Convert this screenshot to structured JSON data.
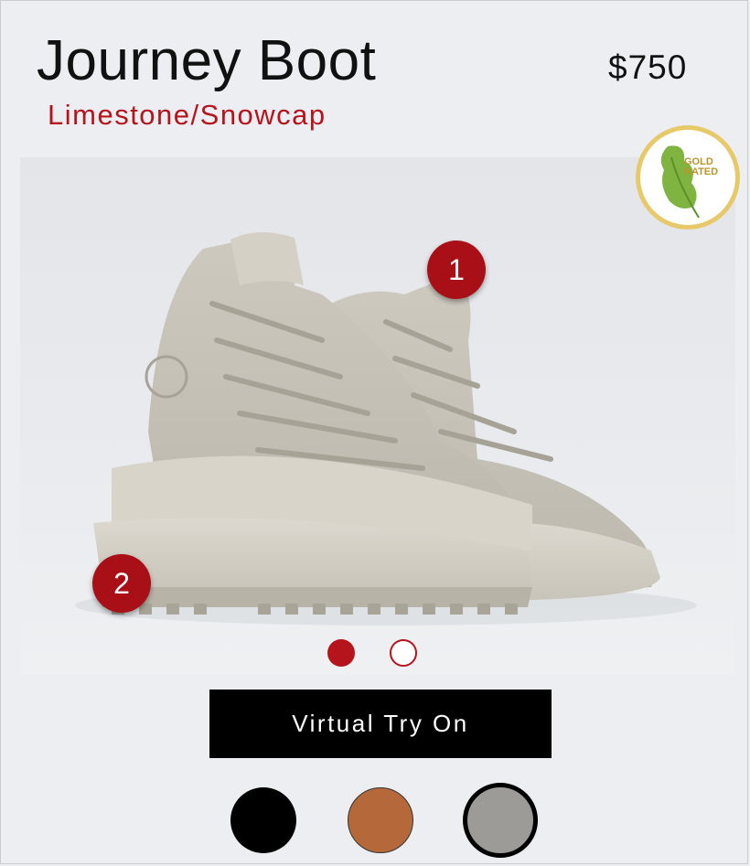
{
  "product": {
    "name": "Journey Boot",
    "colorway": "Limestone/Snowcap",
    "price": "$750"
  },
  "badge": {
    "icon": "leaf-icon",
    "text": "GOLD RATED"
  },
  "hotspots": [
    {
      "label": "1"
    },
    {
      "label": "2"
    }
  ],
  "carousel": {
    "count": 2,
    "active_index": 0
  },
  "actions": {
    "try_on_label": "Virtual Try On"
  },
  "swatches": [
    {
      "color": "#000000",
      "selected": false
    },
    {
      "color": "#b5693a",
      "selected": false
    },
    {
      "color": "#9c9b97",
      "selected": true
    }
  ],
  "colors": {
    "accent": "#b5141c",
    "background": "#eceef1"
  }
}
